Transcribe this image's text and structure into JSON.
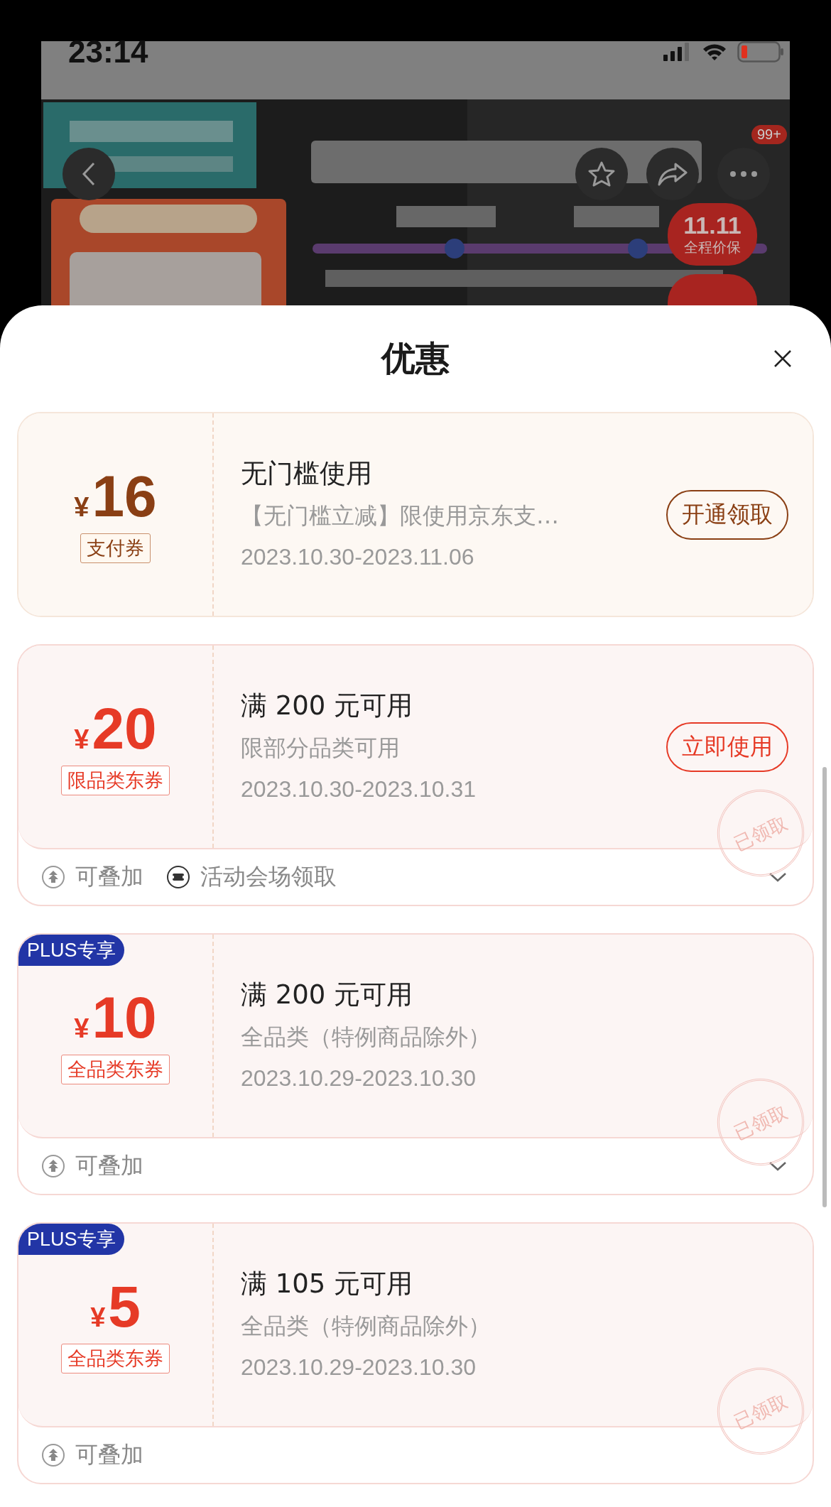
{
  "status_bar": {
    "time": "23:14"
  },
  "product_header": {
    "more_badge": "99+",
    "price_badge": {
      "logo": "11.11",
      "label": "全程价保"
    }
  },
  "sheet": {
    "title": "优惠"
  },
  "coupons": [
    {
      "kind": "payment",
      "currency": "¥",
      "amount": "16",
      "tag": "支付券",
      "title": "无门槛使用",
      "description": "【无门槛立减】限使用京东支…",
      "dates": "2023.10.30-2023.11.06",
      "button": "开通领取"
    },
    {
      "kind": "store",
      "currency": "¥",
      "amount": "20",
      "tag": "限品类东券",
      "title": "满 200 元可用",
      "description": "限部分品类可用",
      "dates": "2023.10.30-2023.10.31",
      "button": "立即使用",
      "stamp": "已领取",
      "footer": {
        "expandable": true,
        "items": [
          {
            "kind": "stack",
            "label": "可叠加"
          },
          {
            "kind": "venue",
            "label": "活动会场领取"
          }
        ]
      }
    },
    {
      "kind": "store",
      "plus_badge": "PLUS专享",
      "currency": "¥",
      "amount": "10",
      "tag": "全品类东券",
      "title": "满 200 元可用",
      "description": "全品类（特例商品除外）",
      "dates": "2023.10.29-2023.10.30",
      "stamp": "已领取",
      "footer": {
        "expandable": true,
        "items": [
          {
            "kind": "stack",
            "label": "可叠加"
          }
        ]
      }
    },
    {
      "kind": "store",
      "plus_badge": "PLUS专享",
      "currency": "¥",
      "amount": "5",
      "tag": "全品类东券",
      "title": "满 105 元可用",
      "description": "全品类（特例商品除外）",
      "dates": "2023.10.29-2023.10.30",
      "stamp": "已领取",
      "footer": {
        "expandable": false,
        "items": [
          {
            "kind": "stack",
            "label": "可叠加"
          }
        ]
      }
    }
  ]
}
